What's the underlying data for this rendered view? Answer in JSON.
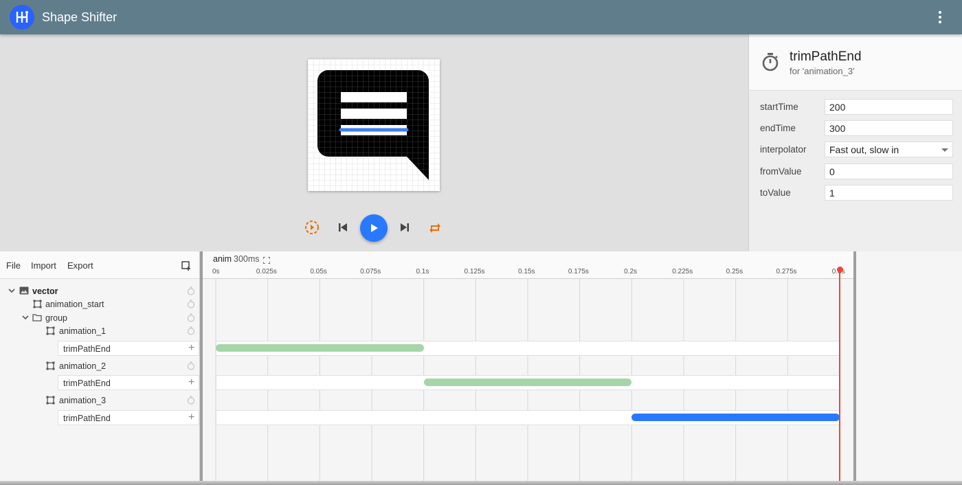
{
  "app": {
    "title": "Shape Shifter",
    "brand_color": "#2962ff",
    "header_color": "#607d8b"
  },
  "canvas": {
    "grid_color": "#d9d9d9",
    "shape_color": "#000000",
    "highlight_color": "#3f7ef0"
  },
  "playback": {
    "buttons": [
      "slow-motion-icon",
      "skip-previous-icon",
      "play-icon",
      "skip-next-icon",
      "repeat-icon"
    ],
    "accent_color": "#ef6c00",
    "play_color": "#2979ff"
  },
  "properties": {
    "title": "trimPathEnd",
    "subtitle": "for 'animation_3'",
    "rows": [
      {
        "label": "startTime",
        "value": "200"
      },
      {
        "label": "endTime",
        "value": "300"
      },
      {
        "label": "interpolator",
        "value": "Fast out, slow in"
      },
      {
        "label": "fromValue",
        "value": "0"
      },
      {
        "label": "toValue",
        "value": "1"
      }
    ]
  },
  "layers": {
    "toolbar": {
      "file": "File",
      "import": "Import",
      "export": "Export"
    },
    "tree": [
      {
        "label": "vector",
        "icon": "image-icon"
      },
      {
        "label": "animation_start",
        "icon": "path-icon"
      },
      {
        "label": "group",
        "icon": "folder-icon"
      },
      {
        "label": "animation_1",
        "icon": "path-icon"
      },
      {
        "label": "animation_2",
        "icon": "path-icon"
      },
      {
        "label": "animation_3",
        "icon": "path-icon"
      }
    ],
    "property_label": "trimPathEnd"
  },
  "timeline": {
    "animation_name": "anim",
    "duration_label": "300ms",
    "duration_ms": 300,
    "ticks": [
      "0s",
      "0.025s",
      "0.05s",
      "0.075s",
      "0.1s",
      "0.125s",
      "0.15s",
      "0.175s",
      "0.2s",
      "0.225s",
      "0.25s",
      "0.275s",
      "0.3s"
    ],
    "blocks": [
      {
        "layer": "animation_1",
        "start": 0,
        "end": 100,
        "selected": false
      },
      {
        "layer": "animation_2",
        "start": 100,
        "end": 200,
        "selected": false
      },
      {
        "layer": "animation_3",
        "start": 200,
        "end": 300,
        "selected": true
      }
    ],
    "playhead_ms": 300,
    "block_color": "#a5d6a7",
    "selected_color": "#2979ff",
    "playhead_color": "#f44336"
  }
}
